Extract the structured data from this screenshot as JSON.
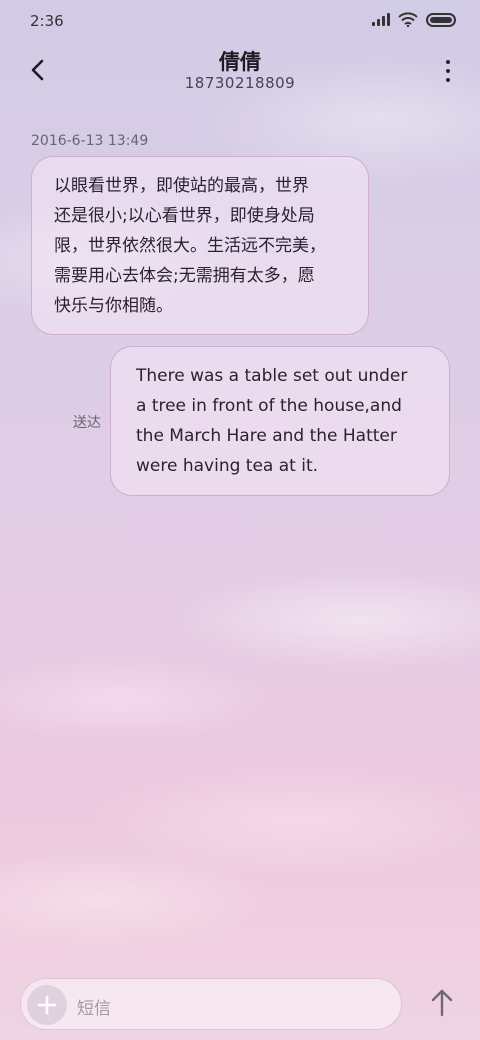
{
  "status_bar": {
    "time": "2:36",
    "icons": [
      "signal-icon",
      "wifi-icon",
      "battery-icon"
    ]
  },
  "header": {
    "contact_name": "倩倩",
    "phone_number": "18730218809",
    "back_icon": "back-arrow-icon",
    "more_icon": "more-vertical-icon"
  },
  "conversation": {
    "timestamp": "2016-6-13 13:49",
    "incoming": {
      "lines": [
        "以眼看世界，即使站的最高，世界",
        "还是很小;以心看世界，即使身处局",
        "限，世界依然很大。生活远不完美，",
        "需要用心去体会;无需拥有太多，愿",
        "快乐与你相随。"
      ]
    },
    "outgoing": {
      "status": "送达",
      "lines": [
        "There was a table set out under",
        "a tree in front of the house,and",
        "the March Hare and the Hatter",
        "were having tea at it."
      ]
    }
  },
  "composer": {
    "placeholder": "短信",
    "add_icon": "plus-icon",
    "send_icon": "send-arrow-icon"
  }
}
